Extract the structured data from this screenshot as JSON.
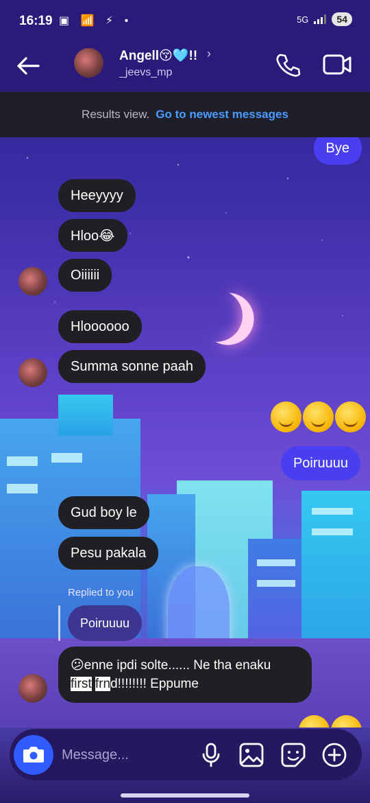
{
  "status": {
    "time": "16:19",
    "left_icons": "▣ 📶 ⚡ •",
    "network": "5G",
    "battery": "54"
  },
  "header": {
    "title": "Angell😚🩵!!",
    "username": "_jeevs_mp"
  },
  "results": {
    "text": "Results view.",
    "link": "Go to newest messages"
  },
  "messages": {
    "bye": "Bye",
    "m1": "Heeyyyy",
    "m2": "Hloo😂",
    "m3": "Oiiiiii",
    "m4": "Hloooooo",
    "m5": "Summa sonne paah",
    "poiruuuu": "Poiruuuu",
    "m6": "Gud boy le",
    "m7": "Pesu pakala",
    "replied_label": "Replied to you",
    "reply_quote": "Poiruuuu",
    "long_line1": "😕enne ipdi solte...... Ne tha enaku",
    "long_first": "first",
    "long_frnd": "frn",
    "long_tail": "d!!!!!!!! Eppume"
  },
  "composer": {
    "placeholder": "Message..."
  },
  "colors": {
    "header_bg": "#2b1a7a",
    "incoming_bubble": "#1f1f24",
    "outgoing_bubble": "#4a3ff0",
    "link": "#4a9cff",
    "camera_button": "#2f5bff"
  }
}
